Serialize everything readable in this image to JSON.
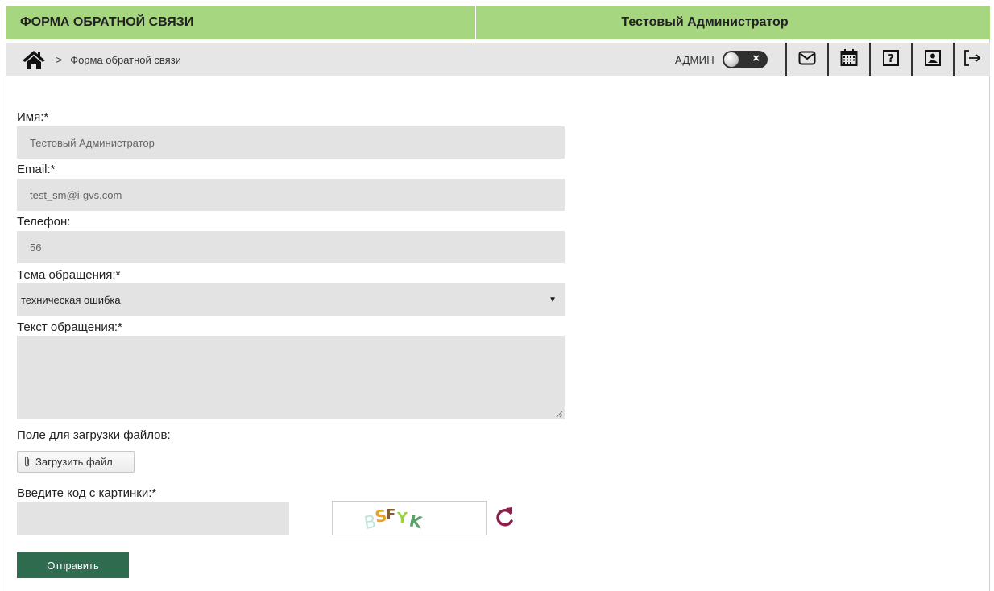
{
  "header": {
    "app_title": "ФОРМА ОБРАТНОЙ СВЯЗИ",
    "user_name": "Тестовый Администратор"
  },
  "breadcrumb": {
    "separator": ">",
    "current": "Форма обратной связи"
  },
  "toolbar": {
    "role_label": "АДМИН",
    "toggle_close": "×",
    "icons": [
      "mail-icon",
      "calendar-icon",
      "help-icon",
      "profile-icon",
      "logout-icon"
    ]
  },
  "form": {
    "name_label": "Имя:*",
    "name_value": "Тестовый Администратор",
    "email_label": "Email:*",
    "email_value": "test_sm@i-gvs.com",
    "phone_label": "Телефон:",
    "phone_value": "56",
    "topic_label": "Тема обращения:*",
    "topic_value": "техническая ошибка",
    "text_label": "Текст обращения:*",
    "text_value": "",
    "upload_label": "Поле для загрузки файлов:",
    "upload_button": "Загрузить файл",
    "captcha_label": "Введите код с картинки:*",
    "captcha_value": "",
    "submit_button": "Отправить"
  },
  "colors": {
    "header_bg": "#a7d680",
    "crumb_bg": "#e6e6e6",
    "field_bg": "#e3e3e3",
    "submit_bg": "#2e6b4f",
    "refresh_icon": "#8e1d4c"
  }
}
